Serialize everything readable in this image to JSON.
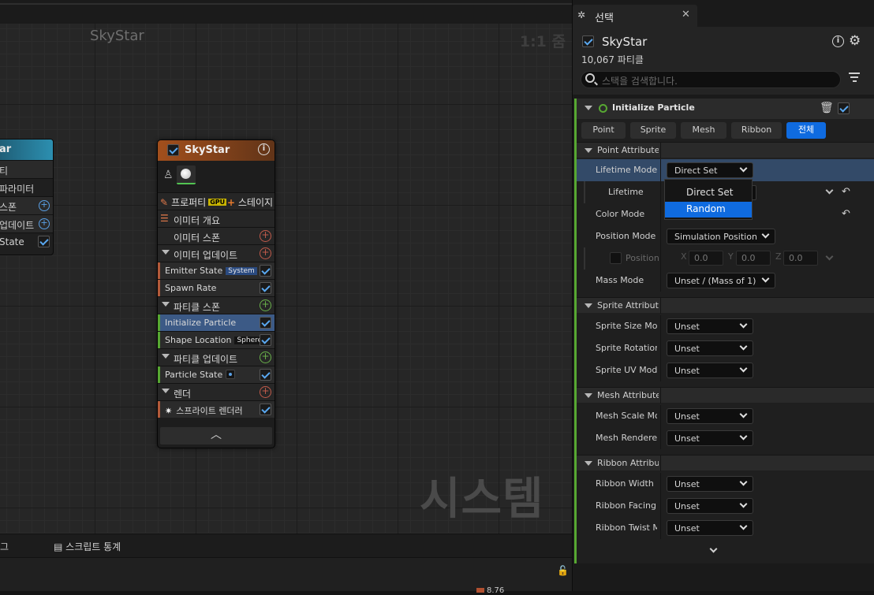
{
  "graph": {
    "title": "SkyStar",
    "zoom": "1:1 줌",
    "watermark": "시스템"
  },
  "left_node": {
    "title": "ar",
    "rows": [
      "티",
      "파라미터",
      "스폰",
      "업데이트",
      "State"
    ]
  },
  "node": {
    "title": "SkyStar",
    "properties_label": "프로퍼티",
    "gpu_badge": "GPU",
    "stage_label": "스테이지",
    "emitter_summary": "이미터 개요",
    "emitter_spawn": "이미터 스폰",
    "emitter_update": "이미터 업데이트",
    "emitter_state": "Emitter State",
    "emitter_state_badge": "System",
    "spawn_rate": "Spawn Rate",
    "particle_spawn": "파티클 스폰",
    "initialize_particle": "Initialize Particle",
    "shape_location": "Shape Location",
    "shape_badge": "Sphere",
    "particle_update": "파티클 업데이트",
    "particle_state": "Particle State",
    "render": "렌더",
    "sprite_renderer": "스프라이트 렌더러"
  },
  "bottom": {
    "tab_left": "그",
    "tab_stats": "스크립트 통계",
    "value": "8.76"
  },
  "panel": {
    "tab_title": "선택",
    "emitter_name": "SkyStar",
    "particle_count": "10,067 파티클",
    "search_placeholder": "스택을 검색합니다.",
    "module_title": "Initialize Particle",
    "tabs": [
      "Point",
      "Sprite",
      "Mesh",
      "Ribbon",
      "전체"
    ],
    "active_tab": "전체",
    "sections": {
      "point": "Point Attributes",
      "sprite": "Sprite Attributes",
      "mesh": "Mesh Attributes",
      "ribbon": "Ribbon Attributes"
    },
    "rows": {
      "lifetime_mode": {
        "label": "Lifetime Mode",
        "value": "Direct Set"
      },
      "lifetime": {
        "label": "Lifetime"
      },
      "color_mode": {
        "label": "Color Mode"
      },
      "position_mode": {
        "label": "Position Mode",
        "value": "Simulation Position"
      },
      "position": {
        "label": "Position",
        "x": "0.0",
        "y": "0.0",
        "z": "0.0"
      },
      "mass_mode": {
        "label": "Mass Mode",
        "value": "Unset / (Mass of 1)"
      },
      "sprite_size_mode": {
        "label": "Sprite Size Mode",
        "value": "Unset"
      },
      "sprite_rotation": {
        "label": "Sprite Rotation",
        "value": "Unset"
      },
      "sprite_uv_mode": {
        "label": "Sprite UV Mode",
        "value": "Unset"
      },
      "mesh_scale_mode": {
        "label": "Mesh Scale Mode",
        "value": "Unset"
      },
      "mesh_renderer": {
        "label": "Mesh Renderer",
        "value": "Unset"
      },
      "ribbon_width_mode": {
        "label": "Ribbon Width Mode",
        "value": "Unset"
      },
      "ribbon_facing_mode": {
        "label": "Ribbon Facing Mode",
        "value": "Unset"
      },
      "ribbon_twist_mode": {
        "label": "Ribbon Twist Mode",
        "value": "Unset"
      }
    },
    "popup_options": [
      "Direct Set",
      "Random"
    ],
    "popup_selected": "Random",
    "axis_labels": {
      "x": "X",
      "y": "Y",
      "z": "Z"
    }
  },
  "colors": {
    "accent_blue": "#0f6be0",
    "module_green": "#57a832",
    "node_header": "#a24f1c",
    "selection": "#3c5a86"
  }
}
